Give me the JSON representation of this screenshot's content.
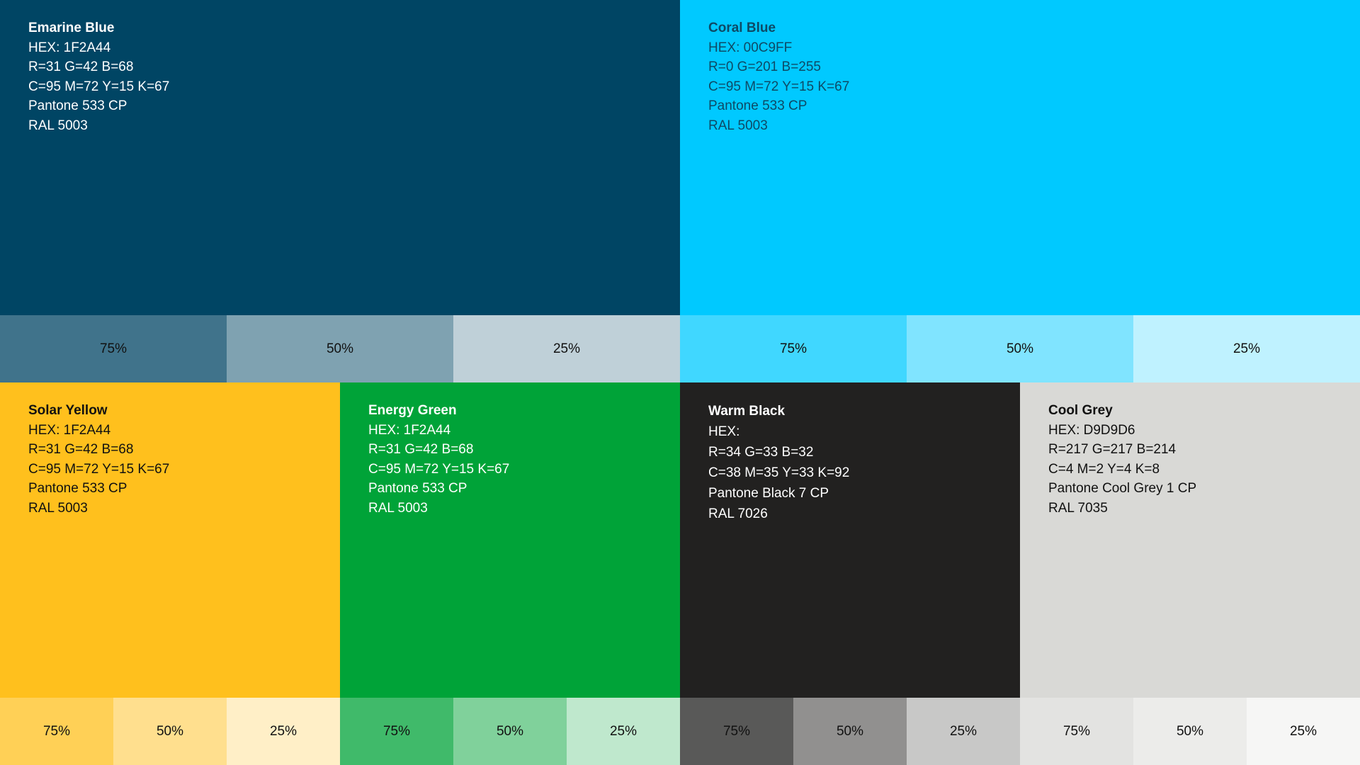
{
  "swatches": {
    "emarine_blue": {
      "name": "Emarine Blue",
      "hex": "HEX: 1F2A44",
      "rgb": "R=31 G=42 B=68",
      "cmyk": "C=95 M=72 Y=15 K=67",
      "pantone": "Pantone 533 CP",
      "ral": "RAL 5003",
      "color": "#004564",
      "text_color": "#ffffff",
      "tints": [
        {
          "label": "75%",
          "color": "#40738b"
        },
        {
          "label": "50%",
          "color": "#7fa2b1"
        },
        {
          "label": "25%",
          "color": "#bfd0d8"
        }
      ]
    },
    "coral_blue": {
      "name": "Coral Blue",
      "hex": "HEX: 00C9FF",
      "rgb": "R=0 G=201 B=255",
      "cmyk": "C=95 M=72 Y=15 K=67",
      "pantone": "Pantone 533 CP",
      "ral": "RAL 5003",
      "color": "#00c9ff",
      "text_color": "#0e4a66",
      "tints": [
        {
          "label": "75%",
          "color": "#40d7ff"
        },
        {
          "label": "50%",
          "color": "#80e4ff"
        },
        {
          "label": "25%",
          "color": "#bff2ff"
        }
      ]
    },
    "solar_yellow": {
      "name": "Solar Yellow",
      "hex": "HEX: 1F2A44",
      "rgb": "R=31 G=42 B=68",
      "cmyk": "C=95 M=72 Y=15 K=67",
      "pantone": "Pantone 533 CP",
      "ral": "RAL 5003",
      "color": "#ffc01d",
      "text_color": "#111111",
      "tints": [
        {
          "label": "75%",
          "color": "#ffd056"
        },
        {
          "label": "50%",
          "color": "#ffdf8e"
        },
        {
          "label": "25%",
          "color": "#ffefc7"
        }
      ]
    },
    "energy_green": {
      "name": "Energy Green",
      "hex": "HEX: 1F2A44",
      "rgb": "R=31 G=42 B=68",
      "cmyk": "C=95 M=72 Y=15 K=67",
      "pantone": "Pantone 533 CP",
      "ral": "RAL 5003",
      "color": "#00a338",
      "text_color": "#ffffff",
      "tints": [
        {
          "label": "75%",
          "color": "#40ba6a"
        },
        {
          "label": "50%",
          "color": "#80d19b"
        },
        {
          "label": "25%",
          "color": "#bfe8cd"
        }
      ]
    },
    "warm_black": {
      "name": "Warm Black",
      "hex": "HEX:",
      "rgb": "R=34 G=33 B=32",
      "cmyk": "C=38 M=35 Y=33 K=92",
      "pantone": "Pantone Black 7 CP",
      "ral": "RAL 7026",
      "color": "#222120",
      "text_color": "#ffffff",
      "tints": [
        {
          "label": "75%",
          "color": "#595958"
        },
        {
          "label": "50%",
          "color": "#91908f"
        },
        {
          "label": "25%",
          "color": "#c8c8c7"
        }
      ]
    },
    "cool_grey": {
      "name": "Cool Grey",
      "hex": "HEX: D9D9D6",
      "rgb": "R=217 G=217 B=214",
      "cmyk": "C=4 M=2 Y=4 K=8",
      "pantone": "Pantone Cool Grey 1 CP",
      "ral": "RAL 7035",
      "color": "#d9d9d6",
      "text_color": "#111111",
      "tints": [
        {
          "label": "75%",
          "color": "#e3e3e1"
        },
        {
          "label": "50%",
          "color": "#ececea"
        },
        {
          "label": "25%",
          "color": "#f6f6f5"
        }
      ]
    }
  }
}
